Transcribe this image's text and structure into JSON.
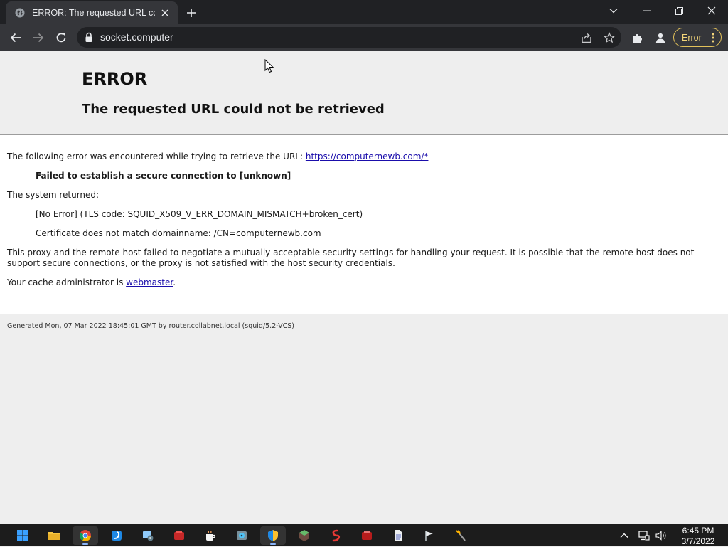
{
  "browser": {
    "tab_title": "ERROR: The requested URL could not be retrieved",
    "url": "socket.computer",
    "profile_chip": "Error"
  },
  "page": {
    "heading": "ERROR",
    "subheading": "The requested URL could not be retrieved",
    "intro": "The following error was encountered while trying to retrieve the URL:",
    "requested_url": "https://computernewb.com/*",
    "error_message": "Failed to establish a secure connection to [unknown]",
    "system_returned_label": "The system returned:",
    "system_detail_1": "[No Error] (TLS code: SQUID_X509_V_ERR_DOMAIN_MISMATCH+broken_cert)",
    "system_detail_2": "Certificate does not match domainname: /CN=computernewb.com",
    "explanation": "This proxy and the remote host failed to negotiate a mutually acceptable security settings for handling your request. It is possible that the remote host does not support secure connections, or the proxy is not satisfied with the host security credentials.",
    "admin_prefix": "Your cache administrator is ",
    "admin_link": "webmaster",
    "admin_suffix": ".",
    "footer": "Generated Mon, 07 Mar 2022 18:45:01 GMT by router.collabnet.local (squid/5.2-VCS)"
  },
  "taskbar": {
    "items": [
      "start-icon",
      "file-explorer-icon",
      "chrome-icon",
      "edge-icon",
      "settings-icon",
      "app-red-icon",
      "coffee-icon",
      "disk-icon",
      "shield-icon",
      "minecraft-icon",
      "scroll-icon",
      "app-red-2-icon",
      "document-icon",
      "flag-icon",
      "tool-icon"
    ],
    "time": "6:45 PM",
    "date": "3/7/2022"
  },
  "colors": {
    "chrome_dark": "#202124",
    "toolbar": "#35363a",
    "link": "#1a0dab",
    "error_chip": "#e2c15a"
  }
}
